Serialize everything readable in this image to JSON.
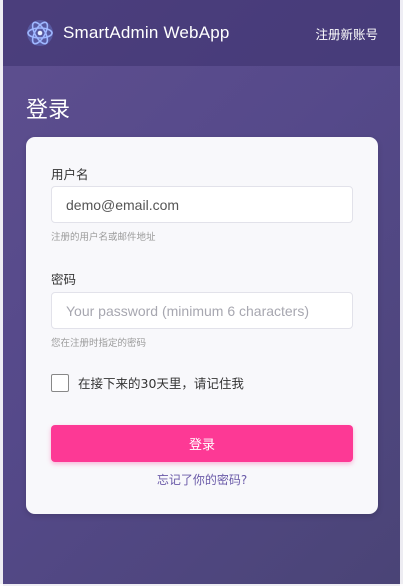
{
  "header": {
    "brand": "SmartAdmin WebApp",
    "register_link": "注册新账号",
    "logo_icon": "atom-logo-icon"
  },
  "page": {
    "title": "登录"
  },
  "form": {
    "username_label": "用户名",
    "username_value": "demo@email.com",
    "username_help": "注册的用户名或邮件地址",
    "password_label": "密码",
    "password_placeholder": "Your password (minimum 6 characters)",
    "password_help": "您在注册时指定的密码",
    "remember_label": "在接下来的30天里，请记住我",
    "remember_checked": false,
    "submit_label": "登录",
    "forgot_link": "忘记了你的密码?"
  },
  "colors": {
    "accent": "#fd3995",
    "link": "#6a5aa8",
    "background": "#584b8a"
  }
}
